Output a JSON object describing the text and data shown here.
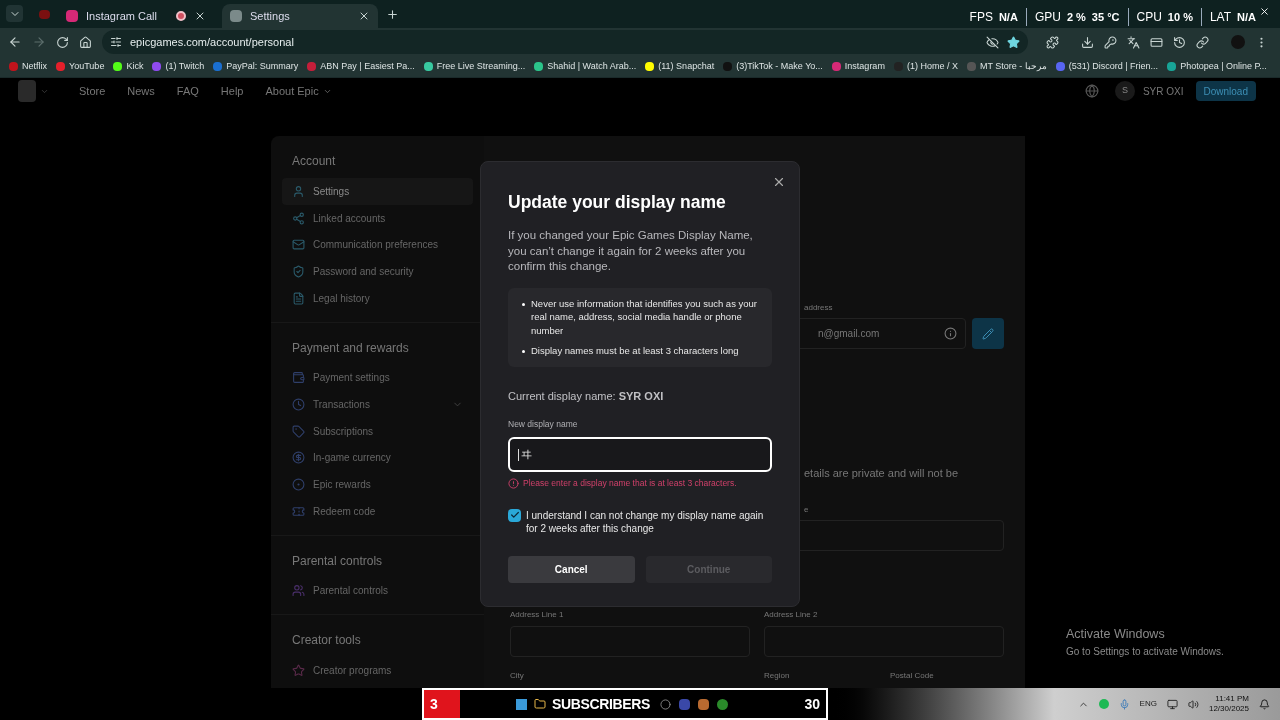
{
  "browser": {
    "tabs": [
      {
        "label": "Instagram Call",
        "selected": false,
        "recording": true
      },
      {
        "label": "Settings",
        "selected": true,
        "recording": false
      }
    ],
    "stats": [
      {
        "label": "FPS",
        "value": "N/A"
      },
      {
        "label": "GPU",
        "value": "2 %",
        "extra": "35 °C"
      },
      {
        "label": "CPU",
        "value": "10 %"
      },
      {
        "label": "LAT",
        "value": "N/A"
      }
    ],
    "address": "epicgames.com/account/personal",
    "bookmarked": true,
    "bookmarks": [
      "Netflix",
      "YouTube",
      "Kick",
      "(1) Twitch",
      "PayPal: Summary",
      "ABN Pay | Easiest Pa...",
      "Free Live Streaming...",
      "Shahid | Watch Arab...",
      "(11) Snapchat",
      "(3)TikTok - Make Yo...",
      "Instagram",
      "(1) Home / X",
      "MT Store - مرحبا",
      "(531) Discord | Frien...",
      "Photopea | Online P..."
    ]
  },
  "nav": {
    "links": [
      {
        "label": "Store",
        "kind": "link"
      },
      {
        "label": "News",
        "kind": "link"
      },
      {
        "label": "FAQ",
        "kind": "link"
      },
      {
        "label": "Help",
        "kind": "link"
      },
      {
        "label": "About Epic",
        "kind": "dropdown"
      }
    ],
    "avatar_letter": "S",
    "user": "SYR OXI",
    "download": "Download"
  },
  "sidebar": [
    {
      "title": "Account",
      "items": [
        {
          "label": "Settings",
          "selected": true,
          "expandable": false
        },
        {
          "label": "Linked accounts",
          "selected": false,
          "expandable": false
        },
        {
          "label": "Communication preferences",
          "selected": false,
          "expandable": false
        },
        {
          "label": "Password and security",
          "selected": false,
          "expandable": false
        },
        {
          "label": "Legal history",
          "selected": false,
          "expandable": false
        }
      ]
    },
    {
      "title": "Payment and rewards",
      "items": [
        {
          "label": "Payment settings",
          "selected": false,
          "expandable": false
        },
        {
          "label": "Transactions",
          "selected": false,
          "expandable": true
        },
        {
          "label": "Subscriptions",
          "selected": false,
          "expandable": false
        },
        {
          "label": "In-game currency",
          "selected": false,
          "expandable": false
        },
        {
          "label": "Epic rewards",
          "selected": false,
          "expandable": false
        },
        {
          "label": "Redeem code",
          "selected": false,
          "expandable": false
        }
      ]
    },
    {
      "title": "Parental controls",
      "items": [
        {
          "label": "Parental controls",
          "selected": false,
          "expandable": false
        }
      ]
    },
    {
      "title": "Creator tools",
      "items": [
        {
          "label": "Creator programs",
          "selected": false,
          "expandable": false
        }
      ]
    }
  ],
  "background": {
    "email_label": "address",
    "email_value": "n@gmail.com",
    "private_note": "etails are private and will not be",
    "field_label": "e",
    "address_labels": [
      "Address Line 1",
      "Address Line 2"
    ],
    "city_labels": [
      "City",
      "Region",
      "Postal Code"
    ]
  },
  "modal": {
    "title": "Update your display name",
    "intro": "If you changed your Epic Games Display Name, you can’t change it again for 2 weeks after you confirm this change.",
    "rules": [
      "Never use information that identifies you such as your real name, address, social media handle or phone number",
      "Display names must be at least 3 characters long"
    ],
    "current": "Current display name: **SYR OXI**",
    "field_label": "New display name",
    "field_value": "ヰ",
    "error": "Please enter a display name that is at least 3 characters.",
    "consent": {
      "label": "I understand I can not change my display name again for 2 weeks after this change",
      "checked": true
    },
    "buttons": [
      {
        "label": "Cancel",
        "disabled": false
      },
      {
        "label": "Continue",
        "disabled": true
      }
    ]
  },
  "watermark": {
    "title": "Activate Windows",
    "subtitle": "Go to Settings to activate Windows."
  },
  "taskbar": {
    "counter": {
      "count": "3",
      "label": "SUBSCRIBERS",
      "goal": "30"
    },
    "language": "ENG",
    "time": "11:41 PM",
    "date": "12/30/2025"
  }
}
